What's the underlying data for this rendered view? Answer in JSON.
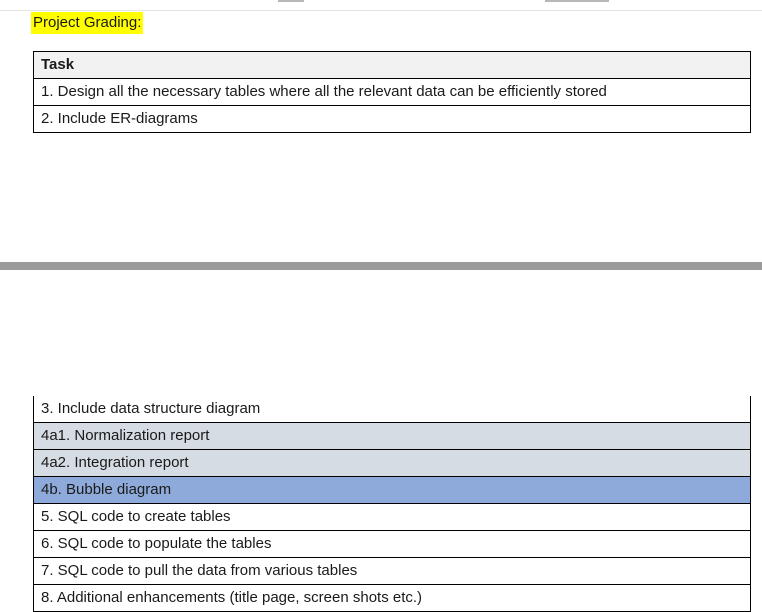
{
  "section": {
    "heading": "Project Grading:",
    "highlight_color": "#ffff00"
  },
  "table": {
    "header": "Task",
    "rows_page1": [
      "1. Design all the necessary tables where all the relevant data can be efficiently stored",
      "2. Include ER-diagrams"
    ],
    "rows_page2": [
      {
        "text": "3. Include data structure diagram",
        "shade": "none"
      },
      {
        "text": "4a1. Normalization report",
        "shade": "light"
      },
      {
        "text": "4a2. Integration report",
        "shade": "light"
      },
      {
        "text": "4b. Bubble diagram",
        "shade": "blue"
      },
      {
        "text": "5. SQL code to create tables",
        "shade": "none"
      },
      {
        "text": "6. SQL code to populate the tables",
        "shade": "none"
      },
      {
        "text": "7. SQL code to pull the data from various tables",
        "shade": "none"
      },
      {
        "text": "8. Additional enhancements  (title page, screen shots etc.)",
        "shade": "none"
      }
    ]
  },
  "colors": {
    "light_shade": "#d6dce4",
    "blue_shade": "#8eaadb",
    "page_gap": "#9b9b9b"
  }
}
